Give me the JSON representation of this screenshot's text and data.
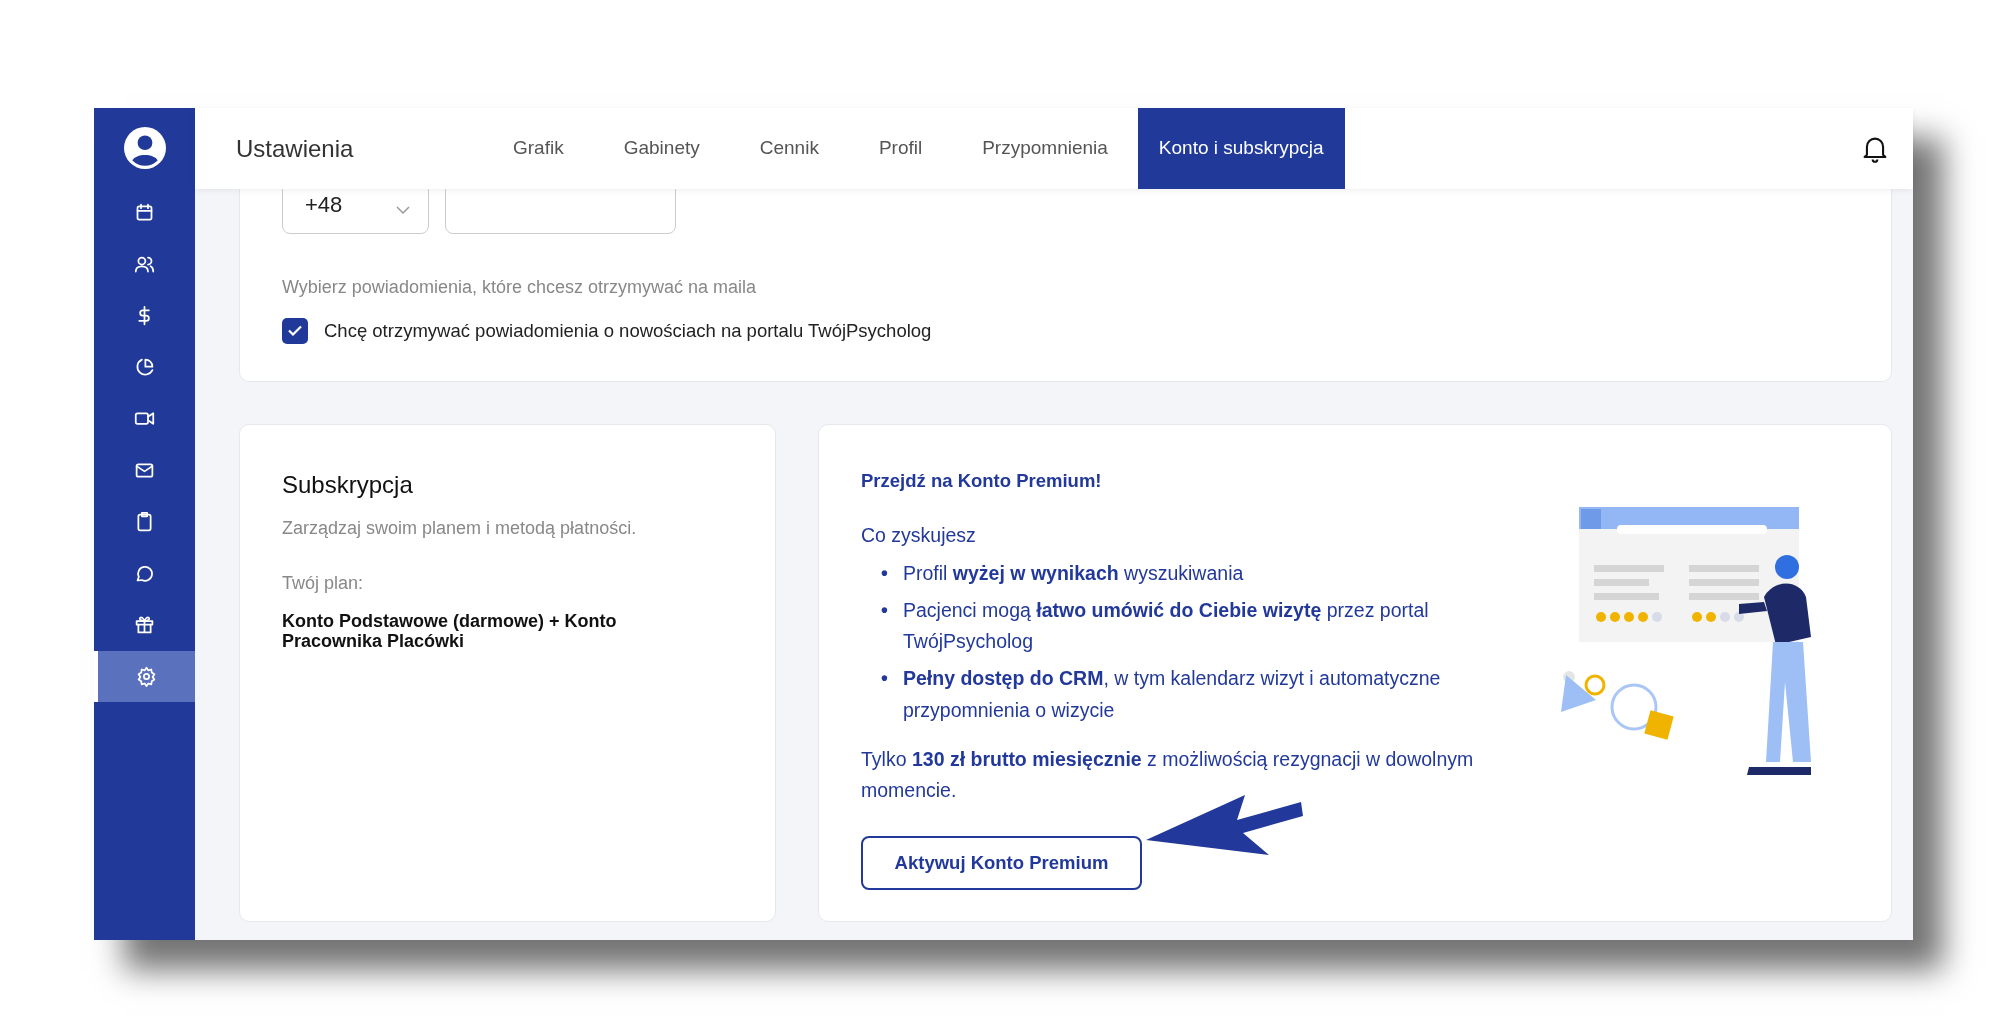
{
  "sidebar": {
    "items": [
      {
        "selected": false
      },
      {
        "selected": false
      },
      {
        "selected": false
      },
      {
        "selected": false
      },
      {
        "selected": false
      },
      {
        "selected": false
      },
      {
        "selected": false
      },
      {
        "selected": false
      },
      {
        "selected": false
      },
      {
        "selected": true
      }
    ]
  },
  "header": {
    "title": "Ustawienia",
    "tabs": [
      {
        "label": "Grafik",
        "selected": false
      },
      {
        "label": "Gabinety",
        "selected": false
      },
      {
        "label": "Cennik",
        "selected": false
      },
      {
        "label": "Profil",
        "selected": false
      },
      {
        "label": "Przypomnienia",
        "selected": false
      },
      {
        "label": "Konto i subskrypcja",
        "selected": true
      }
    ]
  },
  "contact_card": {
    "phone_prefix": "+48",
    "email_label": "Wybierz powiadomienia, które chcesz otrzymywać na maila",
    "newsletter": {
      "label": "Chcę otrzymywać powiadomienia o nowościach na portalu TwójPsycholog",
      "checked": true
    }
  },
  "subscription_card": {
    "title": "Subskrypcja",
    "subtitle": "Zarządzaj swoim planem i metodą płatności.",
    "plan_label": "Twój plan:",
    "plan": "Konto Podstawowe (darmowe) + Konto Pracownika Placówki"
  },
  "premium_card": {
    "title": "Przejdź na Konto Premium!",
    "benefits_heading": "Co zyskujesz",
    "benefits": [
      {
        "bullet": "•",
        "text": "Profil **wyżej w wynikach** wyszukiwania"
      },
      {
        "bullet": "•",
        "text": "Pacjenci mogą **łatwo umówić do Ciebie wizytę** przez portal TwójPsycholog"
      },
      {
        "bullet": "•",
        "text": "**Pełny dostęp do CRM**, w tym kalendarz wizyt i automatyczne przypomnienia o wizycie"
      }
    ],
    "price_note": "Tylko **130 zł brutto miesięcznie** z możliwością rezygnacji w dowolnym momencie.",
    "button": "Aktywuj Konto Premium"
  }
}
